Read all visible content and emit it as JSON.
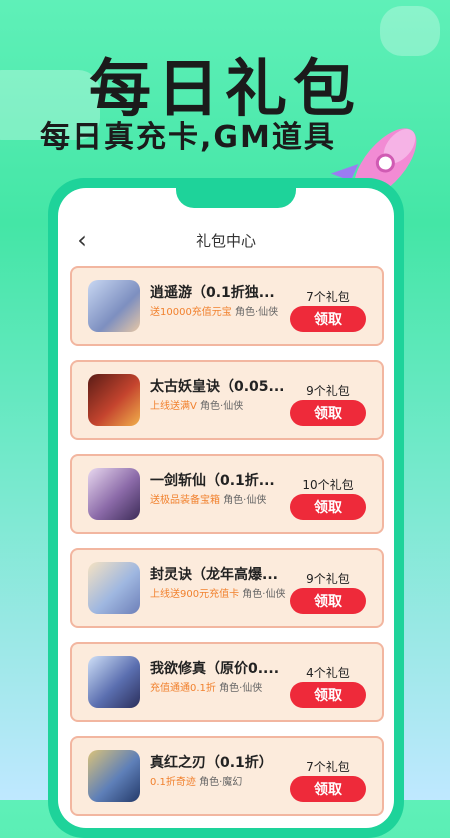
{
  "promo": {
    "title": "每日礼包",
    "subtitle": "每日真充卡,GM道具"
  },
  "header": {
    "title": "礼包中心"
  },
  "gifts": [
    {
      "name": "逍遥游（0.1折独...",
      "highlight": "送10000充值元宝",
      "tags": "角色·仙侠",
      "count": "7个礼包",
      "button": "领取"
    },
    {
      "name": "太古妖皇诀（0.05...",
      "highlight": "上线送满V",
      "tags": "角色·仙侠",
      "count": "9个礼包",
      "button": "领取"
    },
    {
      "name": "一剑斩仙（0.1折...",
      "highlight": "送极品装备宝箱",
      "tags": "角色·仙侠",
      "count": "10个礼包",
      "button": "领取"
    },
    {
      "name": "封灵诀（龙年高爆...",
      "highlight": "上线送900元充值卡",
      "tags": "角色·仙侠",
      "count": "9个礼包",
      "button": "领取"
    },
    {
      "name": "我欲修真（原价0....",
      "highlight": "充值通通0.1折",
      "tags": "角色·仙侠",
      "count": "4个礼包",
      "button": "领取"
    },
    {
      "name": "真红之刃（0.1折）",
      "highlight": "0.1折奇迹",
      "tags": "角色·魔幻",
      "count": "7个礼包",
      "button": "领取"
    }
  ],
  "colors": {
    "accent": "#1ed39a",
    "button": "#ee2a3a",
    "card_bg": "#fcebdc"
  }
}
